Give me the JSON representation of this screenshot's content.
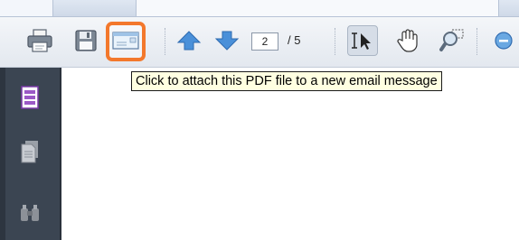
{
  "toolbar": {
    "page_number": "2",
    "page_total": "/ 5",
    "buttons": [
      {
        "name": "print-button",
        "icon": "printer-icon"
      },
      {
        "name": "save-button",
        "icon": "floppy-disk-icon"
      },
      {
        "name": "email-button",
        "icon": "envelope-icon"
      },
      {
        "name": "previous-page-button",
        "icon": "arrow-up-icon"
      },
      {
        "name": "next-page-button",
        "icon": "arrow-down-icon"
      },
      {
        "name": "select-text-tool",
        "icon": "text-select-cursor-icon"
      },
      {
        "name": "hand-tool",
        "icon": "hand-icon"
      },
      {
        "name": "marquee-zoom-tool",
        "icon": "magnifier-icon"
      },
      {
        "name": "zoom-out-button",
        "icon": "minus-circle-icon"
      }
    ],
    "highlight_color": "#f3782c"
  },
  "tooltip": {
    "text": "Click to attach this PDF file to a new email message"
  },
  "nav_panel": {
    "buttons": [
      {
        "name": "bookmarks-button",
        "icon": "bookmark-page-icon"
      },
      {
        "name": "pages-button",
        "icon": "page-icon"
      },
      {
        "name": "find-button",
        "icon": "binoculars-icon"
      }
    ]
  }
}
